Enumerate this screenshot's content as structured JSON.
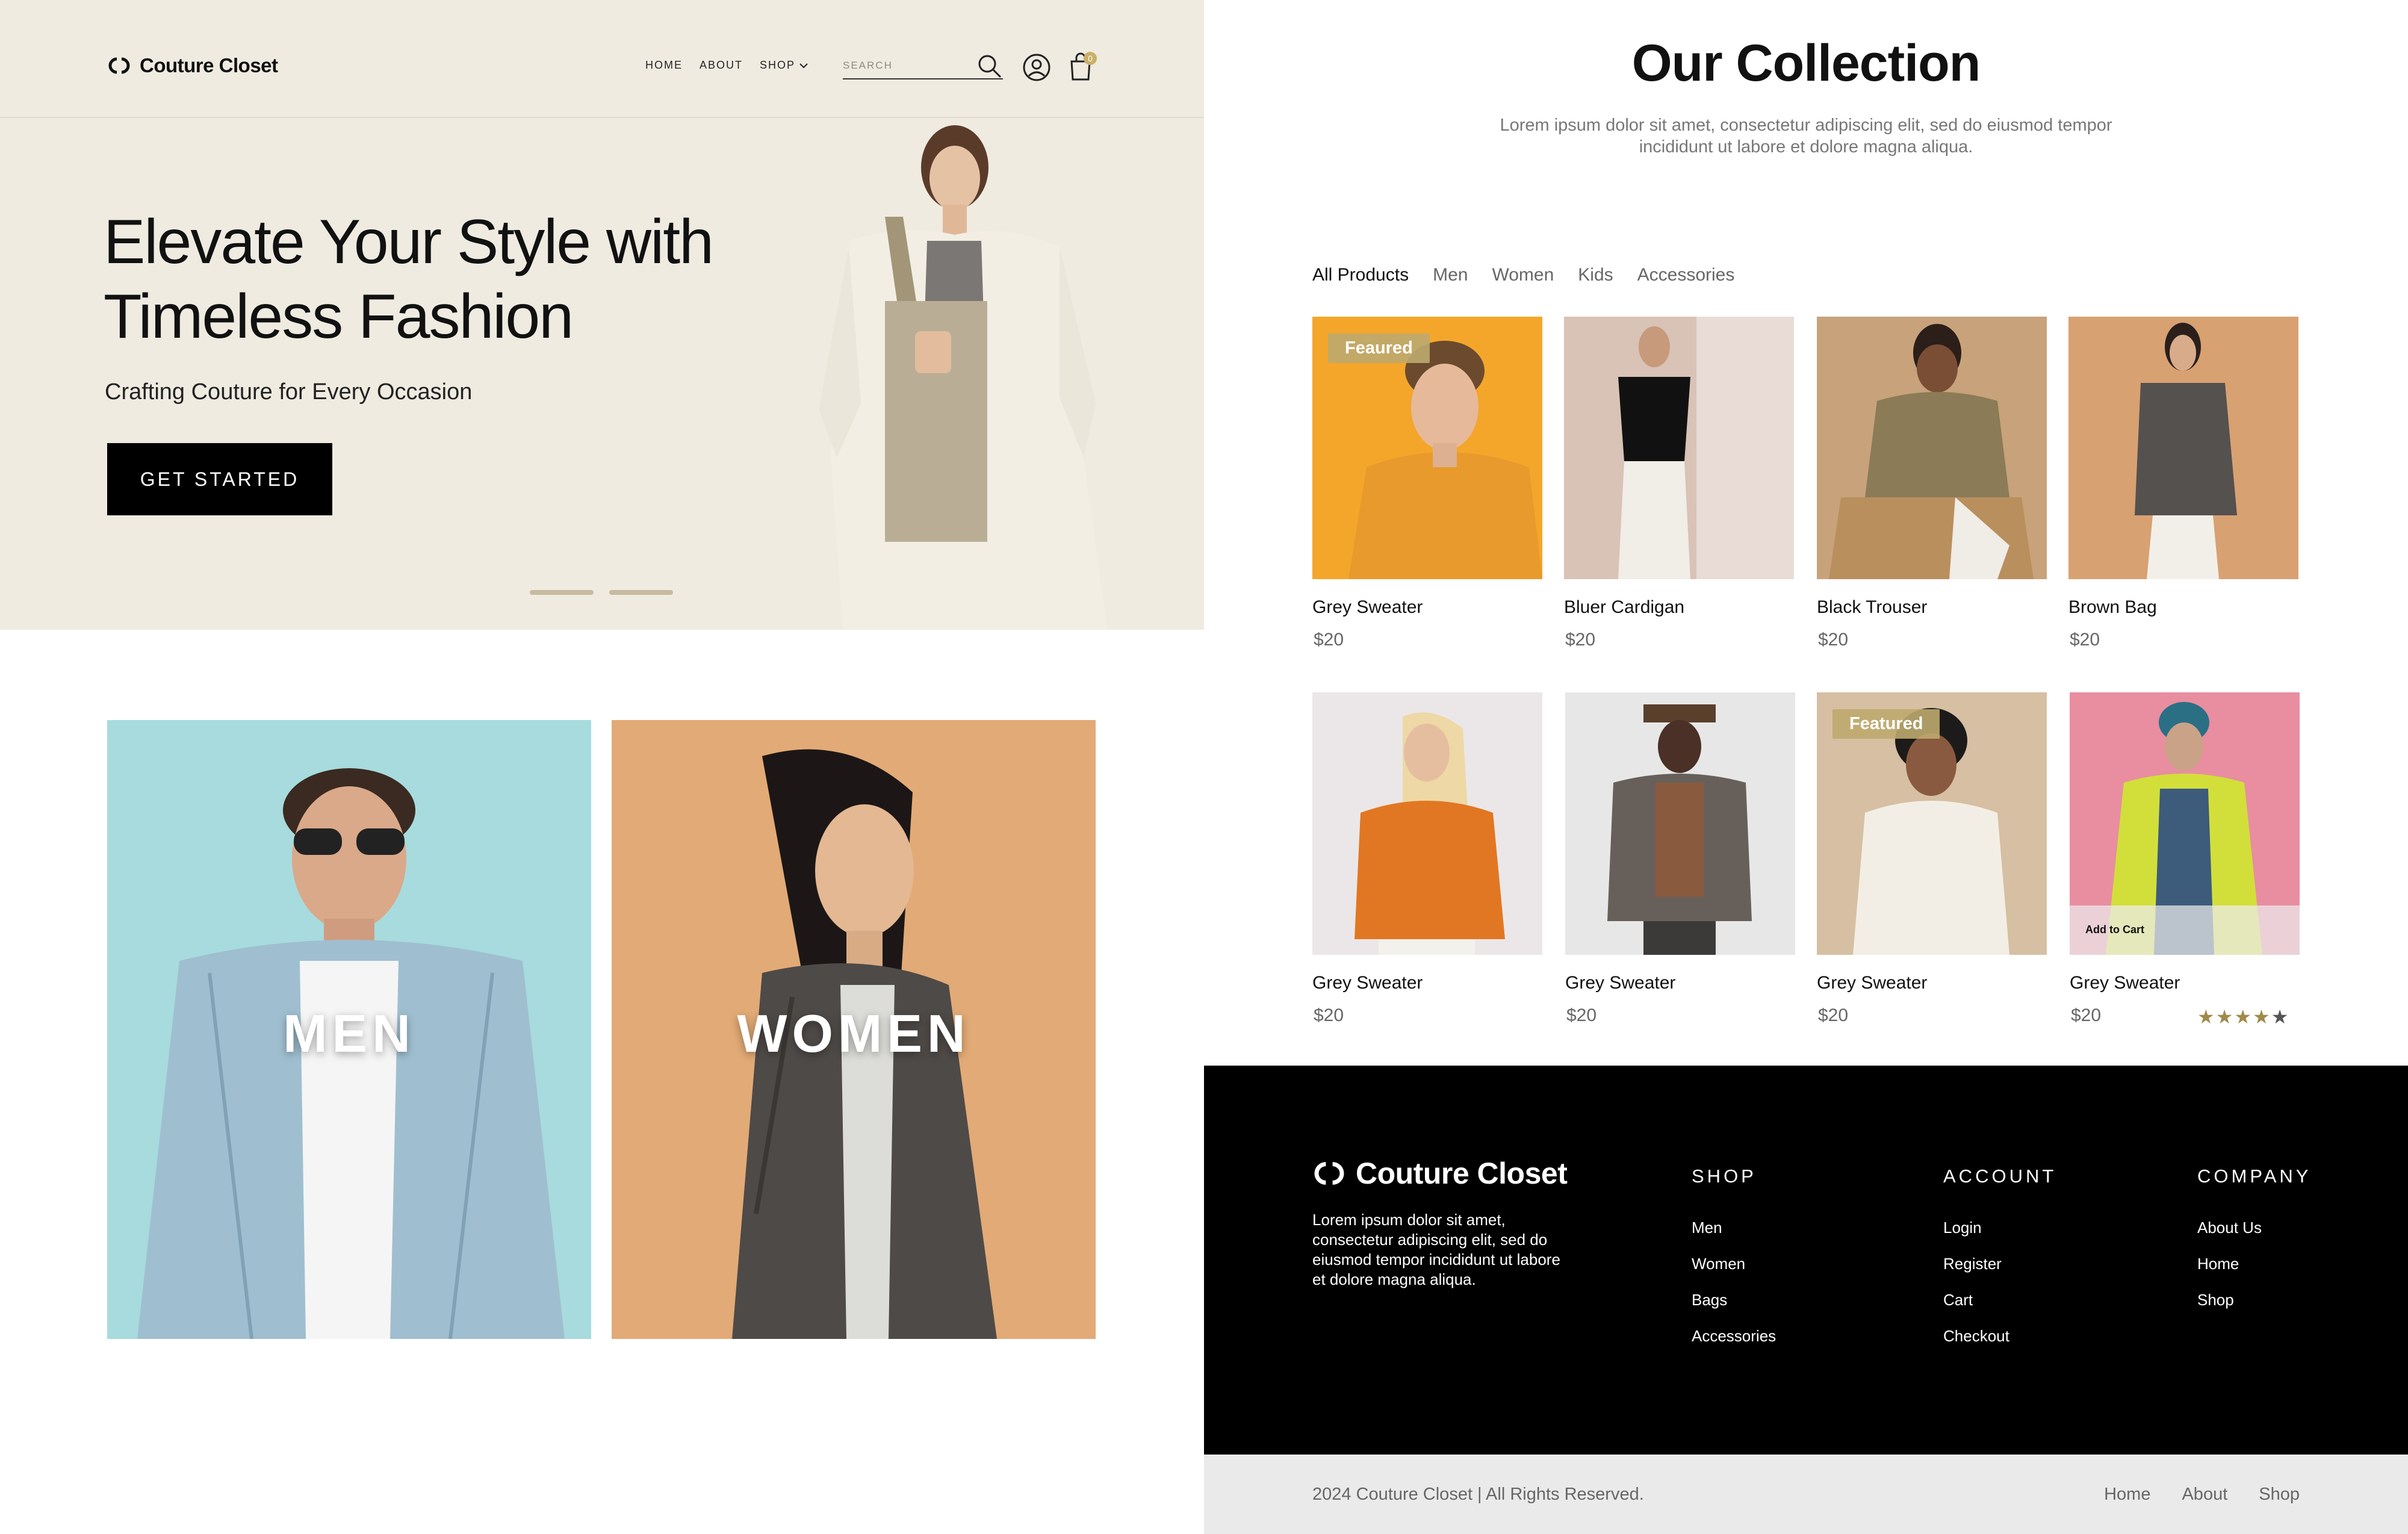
{
  "brand": {
    "name": "Couture Closet"
  },
  "header": {
    "nav": [
      "HOME",
      "ABOUT",
      "SHOP"
    ],
    "search_placeholder": "SEARCH",
    "cart_count": "0"
  },
  "hero": {
    "title": "Elevate Your Style with Timeless Fashion",
    "subtitle": "Crafting Couture for Every Occasion",
    "cta": "GET STARTED",
    "slides": 2
  },
  "categories": [
    {
      "label": "MEN",
      "color": "#a7dbdd"
    },
    {
      "label": "WOMEN",
      "color": "#e2aa76"
    }
  ],
  "collection": {
    "title": "Our Collection",
    "description": "Lorem ipsum dolor sit amet, consectetur adipiscing elit, sed do eiusmod tempor incididunt ut labore et dolore magna aliqua.",
    "filters": [
      "All Products",
      "Men",
      "Women",
      "Kids",
      "Accessories"
    ],
    "active_filter": "All Products",
    "products": [
      {
        "name": "Grey Sweater",
        "price": "$20",
        "badge": "Feaured",
        "bg": "#f4a62b"
      },
      {
        "name": "Bluer Cardigan",
        "price": "$20",
        "bg": "#d9c2b6"
      },
      {
        "name": "Black Trouser",
        "price": "$20",
        "bg": "#c8a27a"
      },
      {
        "name": "Brown Bag",
        "price": "$20",
        "bg": "#d8a172"
      },
      {
        "name": "Grey Sweater",
        "price": "$20",
        "bg": "#ebe7e8"
      },
      {
        "name": "Grey Sweater",
        "price": "$20",
        "bg": "#e7e7e7"
      },
      {
        "name": "Grey Sweater",
        "price": "$20",
        "badge": "Featured",
        "bg": "#d6bfa2"
      },
      {
        "name": "Grey Sweater",
        "price": "$20",
        "add_to_cart": "Add to Cart",
        "rating": 4,
        "rating_max": 5,
        "bg": "#e88ea0"
      }
    ]
  },
  "footer": {
    "description": "Lorem ipsum dolor sit amet, consectetur adipiscing elit, sed do eiusmod tempor incididunt ut labore et dolore magna aliqua.",
    "columns": [
      {
        "title": "SHOP",
        "links": [
          "Men",
          "Women",
          "Bags",
          "Accessories"
        ]
      },
      {
        "title": "ACCOUNT",
        "links": [
          "Login",
          "Register",
          "Cart",
          "Checkout"
        ]
      },
      {
        "title": "COMPANY",
        "links": [
          "About Us",
          "Home",
          "Shop"
        ]
      }
    ],
    "copyright": "2024 Couture Closet | All Rights Reserved.",
    "bottom_links": [
      "Home",
      "About",
      "Shop"
    ]
  },
  "colors": {
    "hero_bg": "#efebe1",
    "cta_bg": "#000000",
    "accent_gold": "#a08a4a",
    "footer_bg": "#000000",
    "copyright_bg": "#eaeaea"
  },
  "icons": [
    "brand-logo-icon",
    "search-icon",
    "user-icon",
    "shopping-bag-icon",
    "chevron-down-icon",
    "star-icon"
  ]
}
